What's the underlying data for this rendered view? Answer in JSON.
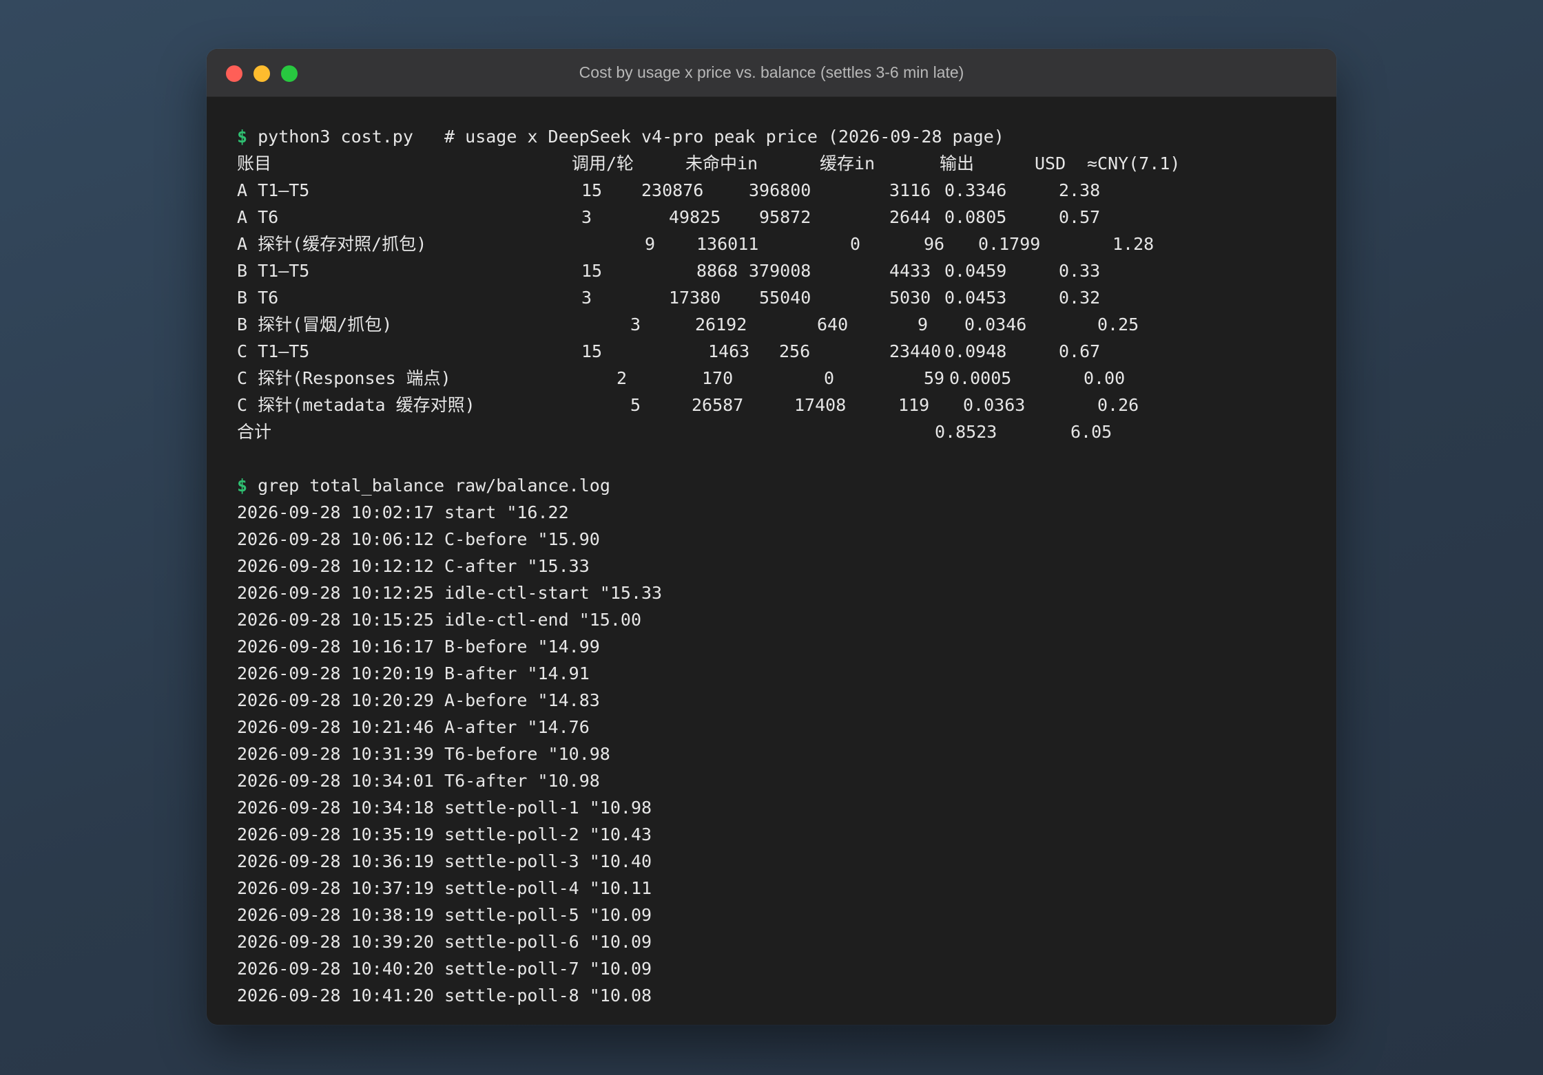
{
  "window": {
    "title": "Cost by usage x price vs. balance (settles 3-6 min late)"
  },
  "cost_command": {
    "prompt": "$",
    "command": "python3 cost.py   # usage x DeepSeek v4-pro peak price (2026-09-28 page)"
  },
  "cost_table": {
    "headers": {
      "account": "账目",
      "calls": "调用/轮",
      "miss_in": "未命中in",
      "cache_in": "缓存in",
      "output": "输出",
      "usd": "USD",
      "cny": "≈CNY(7.1)"
    },
    "rows": [
      {
        "account": "A T1–T5",
        "calls": "15",
        "miss_in": "230876",
        "cache_in": "396800",
        "output": "3116",
        "usd": "0.3346",
        "cny": "2.38"
      },
      {
        "account": "A T6",
        "calls": "3",
        "miss_in": "49825",
        "cache_in": "95872",
        "output": "2644",
        "usd": "0.0805",
        "cny": "0.57"
      },
      {
        "account": "A 探针(缓存对照/抓包)",
        "calls": "9",
        "miss_in": "136011",
        "cache_in": "0",
        "output": "96",
        "usd": "0.1799",
        "cny": "1.28"
      },
      {
        "account": "B T1–T5",
        "calls": "15",
        "miss_in": "8868",
        "cache_in": "379008",
        "output": "4433",
        "usd": "0.0459",
        "cny": "0.33"
      },
      {
        "account": "B T6",
        "calls": "3",
        "miss_in": "17380",
        "cache_in": "55040",
        "output": "5030",
        "usd": "0.0453",
        "cny": "0.32"
      },
      {
        "account": "B 探针(冒烟/抓包)",
        "calls": "3",
        "miss_in": "26192",
        "cache_in": "640",
        "output": "9",
        "usd": "0.0346",
        "cny": "0.25"
      },
      {
        "account": "C T1–T5",
        "calls": "15",
        "miss_in": "1463",
        "cache_in": "256",
        "output": "23440",
        "usd": "0.0948",
        "cny": "0.67"
      },
      {
        "account": "C 探针(Responses 端点)",
        "calls": "2",
        "miss_in": "170",
        "cache_in": "0",
        "output": "59",
        "usd": "0.0005",
        "cny": "0.00"
      },
      {
        "account": "C 探针(metadata 缓存对照)",
        "calls": "5",
        "miss_in": "26587",
        "cache_in": "17408",
        "output": "119",
        "usd": "0.0363",
        "cny": "0.26"
      }
    ],
    "total": {
      "label": "合计",
      "usd": "0.8523",
      "cny": "6.05"
    }
  },
  "balance_command": {
    "prompt": "$",
    "command": "grep total_balance raw/balance.log"
  },
  "balance_log": [
    "2026-09-28 10:02:17 start \"16.22",
    "2026-09-28 10:06:12 C-before \"15.90",
    "2026-09-28 10:12:12 C-after \"15.33",
    "2026-09-28 10:12:25 idle-ctl-start \"15.33",
    "2026-09-28 10:15:25 idle-ctl-end \"15.00",
    "2026-09-28 10:16:17 B-before \"14.99",
    "2026-09-28 10:20:19 B-after \"14.91",
    "2026-09-28 10:20:29 A-before \"14.83",
    "2026-09-28 10:21:46 A-after \"14.76",
    "2026-09-28 10:31:39 T6-before \"10.98",
    "2026-09-28 10:34:01 T6-after \"10.98",
    "2026-09-28 10:34:18 settle-poll-1 \"10.98",
    "2026-09-28 10:35:19 settle-poll-2 \"10.43",
    "2026-09-28 10:36:19 settle-poll-3 \"10.40",
    "2026-09-28 10:37:19 settle-poll-4 \"10.11",
    "2026-09-28 10:38:19 settle-poll-5 \"10.09",
    "2026-09-28 10:39:20 settle-poll-6 \"10.09",
    "2026-09-28 10:40:20 settle-poll-7 \"10.09",
    "2026-09-28 10:41:20 settle-poll-8 \"10.08"
  ]
}
